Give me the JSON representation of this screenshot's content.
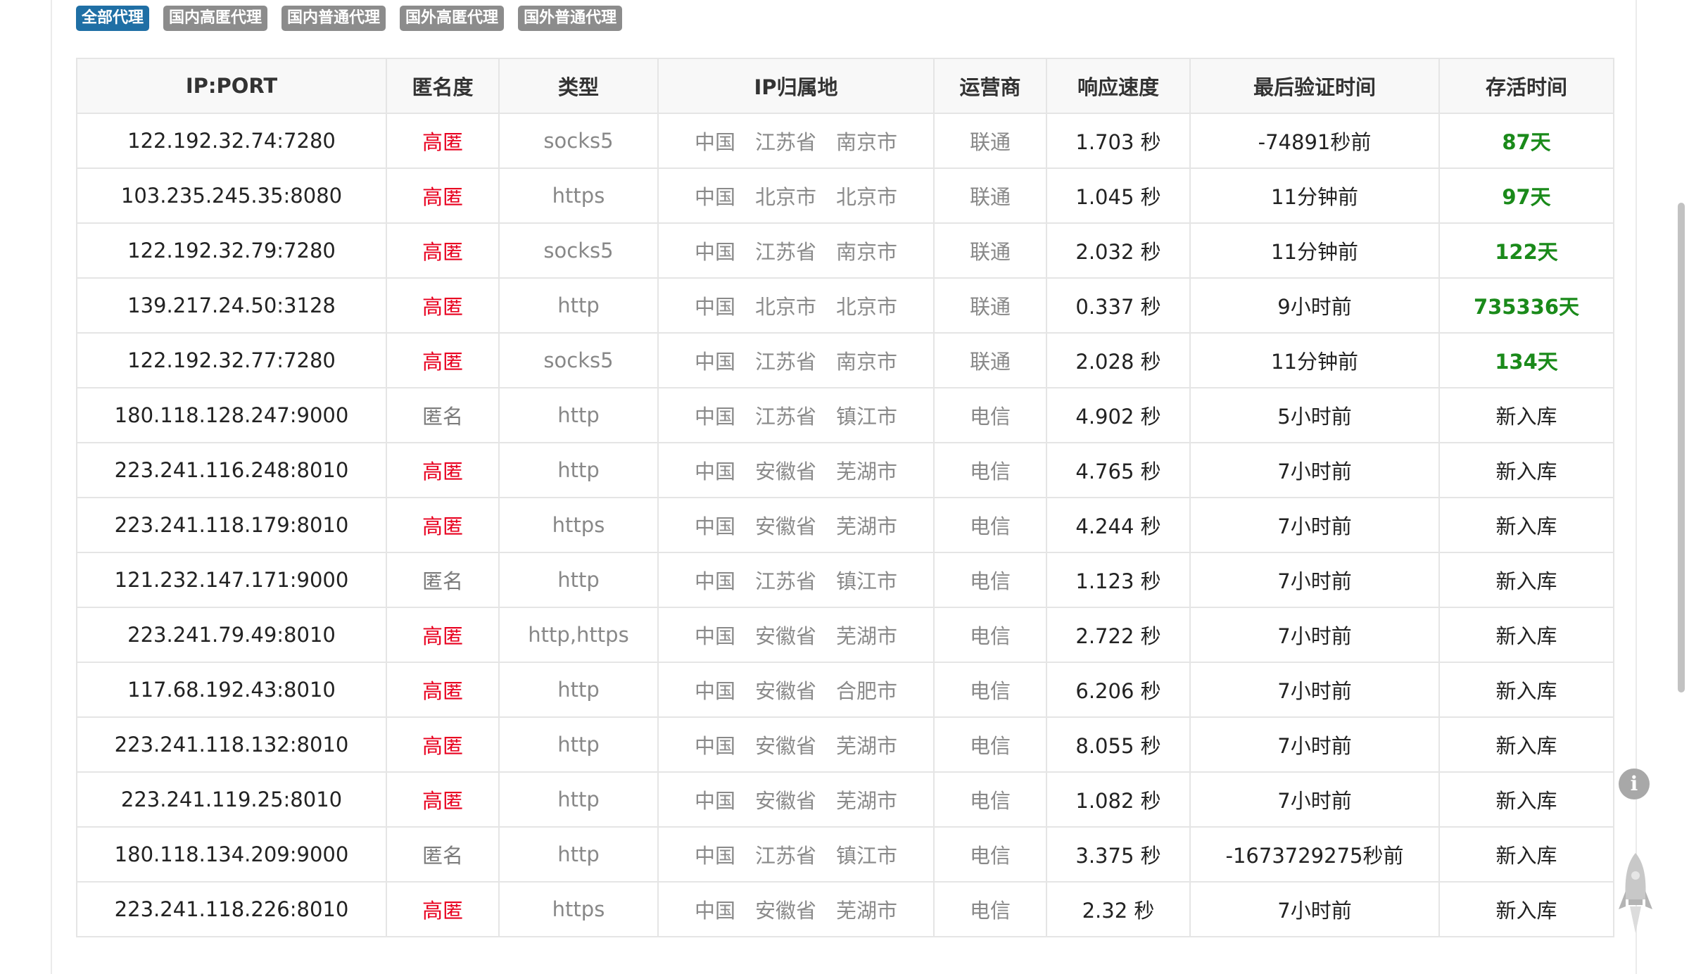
{
  "tabs": [
    {
      "label": "全部代理",
      "active": true
    },
    {
      "label": "国内高匿代理",
      "active": false
    },
    {
      "label": "国内普通代理",
      "active": false
    },
    {
      "label": "国外高匿代理",
      "active": false
    },
    {
      "label": "国外普通代理",
      "active": false
    }
  ],
  "table": {
    "headers": {
      "ip_port": "IP:PORT",
      "anonymity": "匿名度",
      "type": "类型",
      "location": "IP归属地",
      "isp": "运营商",
      "speed": "响应速度",
      "last_verified": "最后验证时间",
      "alive": "存活时间"
    },
    "rows": [
      {
        "ip_port": "122.192.32.74:7280",
        "anonymity": "高匿",
        "high": true,
        "type": "socks5",
        "country": "中国",
        "province": "江苏省",
        "city": "南京市",
        "isp": "联通",
        "speed": "1.703 秒",
        "last_verified": "-74891秒前",
        "alive": "87天",
        "alive_highlight": true
      },
      {
        "ip_port": "103.235.245.35:8080",
        "anonymity": "高匿",
        "high": true,
        "type": "https",
        "country": "中国",
        "province": "北京市",
        "city": "北京市",
        "isp": "联通",
        "speed": "1.045 秒",
        "last_verified": "11分钟前",
        "alive": "97天",
        "alive_highlight": true
      },
      {
        "ip_port": "122.192.32.79:7280",
        "anonymity": "高匿",
        "high": true,
        "type": "socks5",
        "country": "中国",
        "province": "江苏省",
        "city": "南京市",
        "isp": "联通",
        "speed": "2.032 秒",
        "last_verified": "11分钟前",
        "alive": "122天",
        "alive_highlight": true
      },
      {
        "ip_port": "139.217.24.50:3128",
        "anonymity": "高匿",
        "high": true,
        "type": "http",
        "country": "中国",
        "province": "北京市",
        "city": "北京市",
        "isp": "联通",
        "speed": "0.337 秒",
        "last_verified": "9小时前",
        "alive": "735336天",
        "alive_highlight": true
      },
      {
        "ip_port": "122.192.32.77:7280",
        "anonymity": "高匿",
        "high": true,
        "type": "socks5",
        "country": "中国",
        "province": "江苏省",
        "city": "南京市",
        "isp": "联通",
        "speed": "2.028 秒",
        "last_verified": "11分钟前",
        "alive": "134天",
        "alive_highlight": true
      },
      {
        "ip_port": "180.118.128.247:9000",
        "anonymity": "匿名",
        "high": false,
        "type": "http",
        "country": "中国",
        "province": "江苏省",
        "city": "镇江市",
        "isp": "电信",
        "speed": "4.902 秒",
        "last_verified": "5小时前",
        "alive": "新入库",
        "alive_highlight": false
      },
      {
        "ip_port": "223.241.116.248:8010",
        "anonymity": "高匿",
        "high": true,
        "type": "http",
        "country": "中国",
        "province": "安徽省",
        "city": "芜湖市",
        "isp": "电信",
        "speed": "4.765 秒",
        "last_verified": "7小时前",
        "alive": "新入库",
        "alive_highlight": false
      },
      {
        "ip_port": "223.241.118.179:8010",
        "anonymity": "高匿",
        "high": true,
        "type": "https",
        "country": "中国",
        "province": "安徽省",
        "city": "芜湖市",
        "isp": "电信",
        "speed": "4.244 秒",
        "last_verified": "7小时前",
        "alive": "新入库",
        "alive_highlight": false
      },
      {
        "ip_port": "121.232.147.171:9000",
        "anonymity": "匿名",
        "high": false,
        "type": "http",
        "country": "中国",
        "province": "江苏省",
        "city": "镇江市",
        "isp": "电信",
        "speed": "1.123 秒",
        "last_verified": "7小时前",
        "alive": "新入库",
        "alive_highlight": false
      },
      {
        "ip_port": "223.241.79.49:8010",
        "anonymity": "高匿",
        "high": true,
        "type": "http,https",
        "country": "中国",
        "province": "安徽省",
        "city": "芜湖市",
        "isp": "电信",
        "speed": "2.722 秒",
        "last_verified": "7小时前",
        "alive": "新入库",
        "alive_highlight": false
      },
      {
        "ip_port": "117.68.192.43:8010",
        "anonymity": "高匿",
        "high": true,
        "type": "http",
        "country": "中国",
        "province": "安徽省",
        "city": "合肥市",
        "isp": "电信",
        "speed": "6.206 秒",
        "last_verified": "7小时前",
        "alive": "新入库",
        "alive_highlight": false
      },
      {
        "ip_port": "223.241.118.132:8010",
        "anonymity": "高匿",
        "high": true,
        "type": "http",
        "country": "中国",
        "province": "安徽省",
        "city": "芜湖市",
        "isp": "电信",
        "speed": "8.055 秒",
        "last_verified": "7小时前",
        "alive": "新入库",
        "alive_highlight": false
      },
      {
        "ip_port": "223.241.119.25:8010",
        "anonymity": "高匿",
        "high": true,
        "type": "http",
        "country": "中国",
        "province": "安徽省",
        "city": "芜湖市",
        "isp": "电信",
        "speed": "1.082 秒",
        "last_verified": "7小时前",
        "alive": "新入库",
        "alive_highlight": false
      },
      {
        "ip_port": "180.118.134.209:9000",
        "anonymity": "匿名",
        "high": false,
        "type": "http",
        "country": "中国",
        "province": "江苏省",
        "city": "镇江市",
        "isp": "电信",
        "speed": "3.375 秒",
        "last_verified": "-1673729275秒前",
        "alive": "新入库",
        "alive_highlight": false
      },
      {
        "ip_port": "223.241.118.226:8010",
        "anonymity": "高匿",
        "high": true,
        "type": "https",
        "country": "中国",
        "province": "安徽省",
        "city": "芜湖市",
        "isp": "电信",
        "speed": "2.32 秒",
        "last_verified": "7小时前",
        "alive": "新入库",
        "alive_highlight": false
      }
    ]
  },
  "floating": {
    "info_icon": "info-icon",
    "info_glyph": "i",
    "rocket_icon": "rocket-icon"
  },
  "colors": {
    "tab_active": "#1f6fa5",
    "tab_inactive": "#8c8c8c",
    "high_anonymity": "#e8001f",
    "alive_highlight": "#1a8a1a"
  }
}
